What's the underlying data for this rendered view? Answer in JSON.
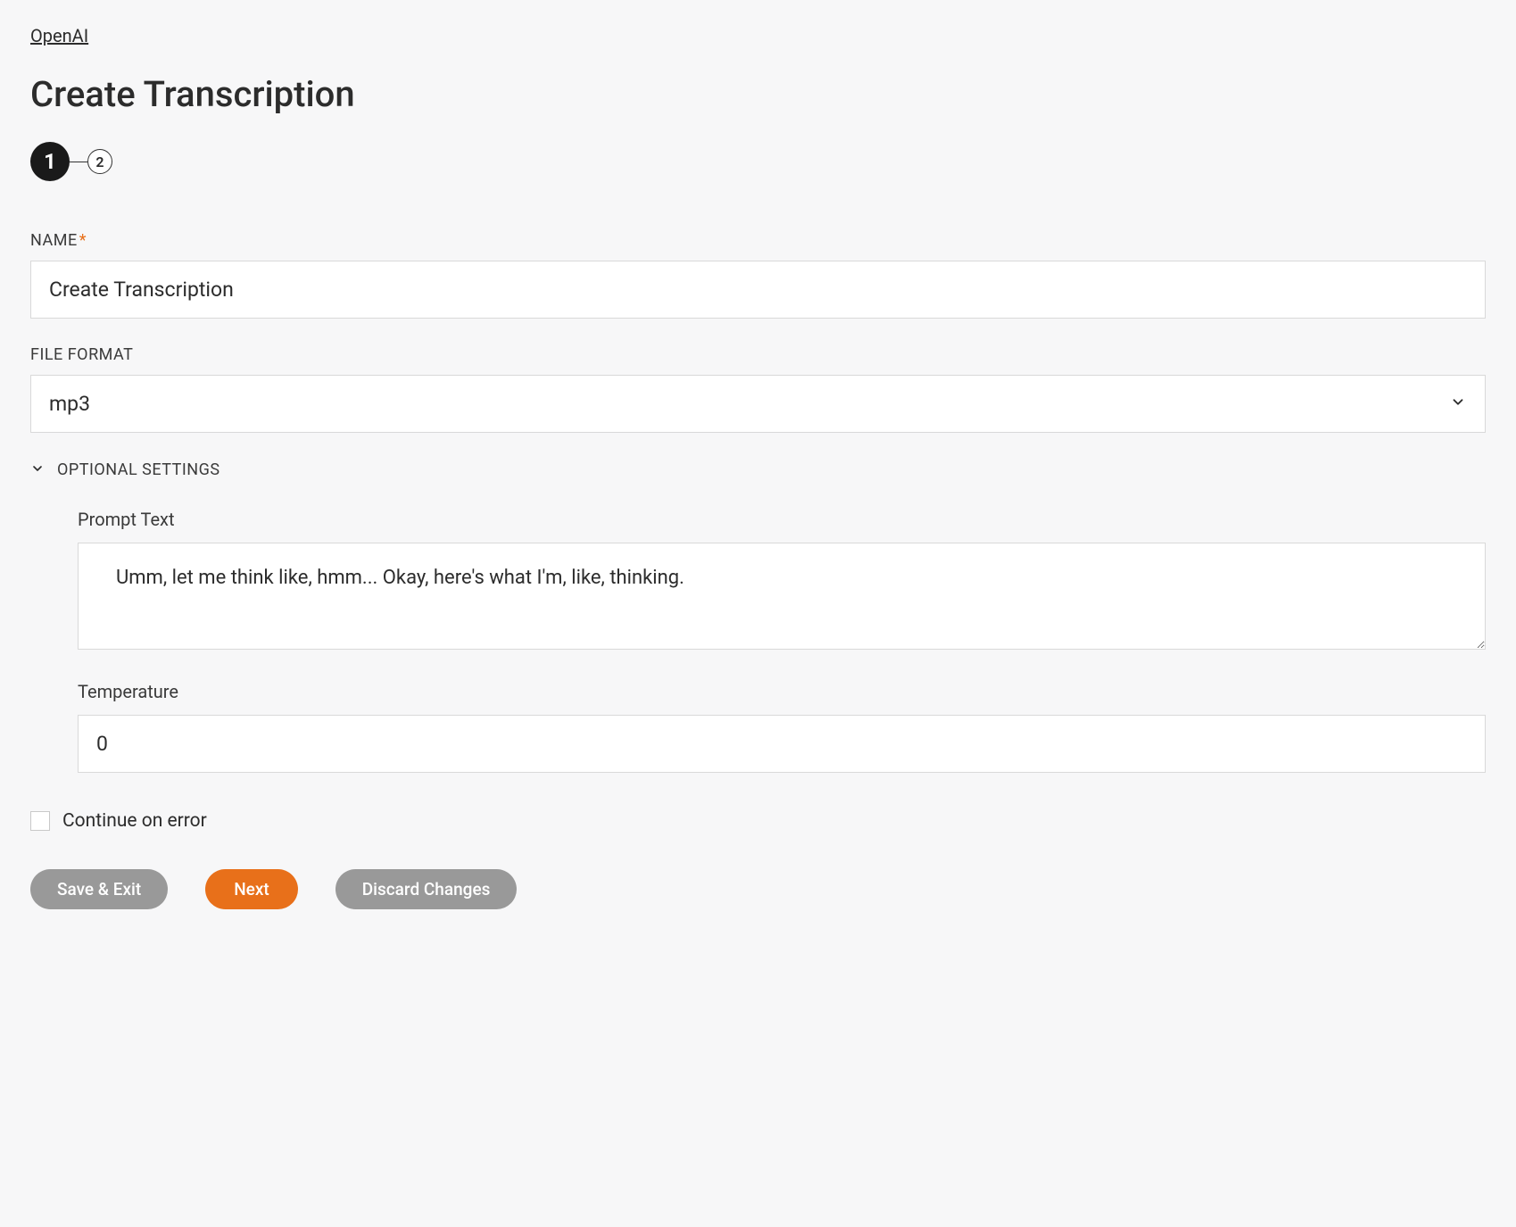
{
  "breadcrumb": "OpenAI",
  "page_title": "Create Transcription",
  "stepper": {
    "steps": [
      "1",
      "2"
    ],
    "active_index": 0
  },
  "fields": {
    "name": {
      "label": "NAME",
      "required": true,
      "value": "Create Transcription"
    },
    "file_format": {
      "label": "FILE FORMAT",
      "value": "mp3"
    }
  },
  "optional_settings": {
    "label": "OPTIONAL SETTINGS",
    "expanded": true,
    "prompt_text": {
      "label": "Prompt Text",
      "value": "Umm, let me think like, hmm... Okay, here's what I'm, like, thinking."
    },
    "temperature": {
      "label": "Temperature",
      "value": "0"
    }
  },
  "continue_on_error": {
    "label": "Continue on error",
    "checked": false
  },
  "buttons": {
    "save_exit": "Save & Exit",
    "next": "Next",
    "discard": "Discard Changes"
  }
}
